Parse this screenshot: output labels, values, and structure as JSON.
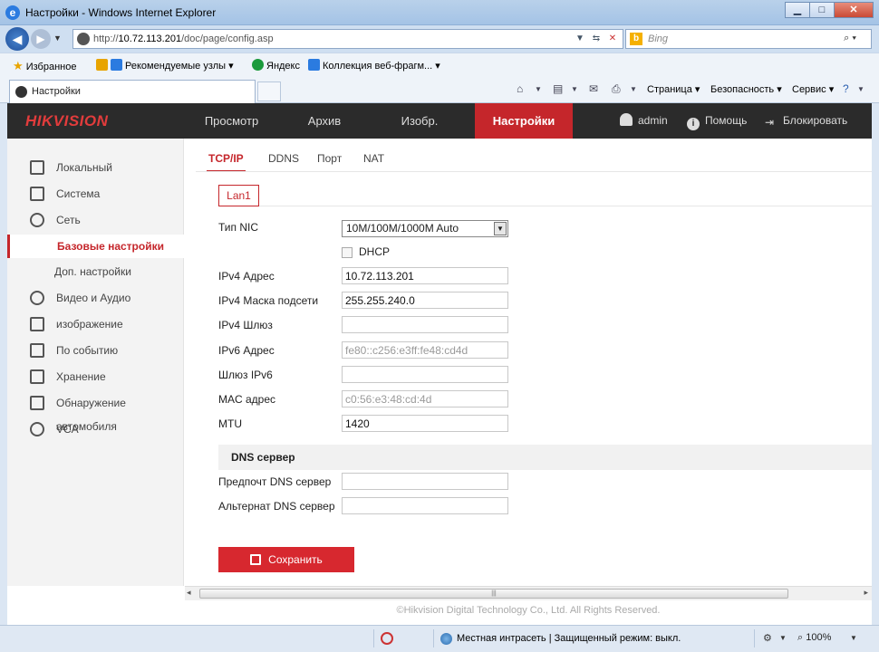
{
  "browser": {
    "window_title": "Настройки - Windows Internet Explorer",
    "address_prefix": "http://",
    "address_host": "10.72.113.201",
    "address_path": "/doc/page/config.asp",
    "search_placeholder": "Bing",
    "favorites_label": "Избранное",
    "fav_links": [
      "Рекомендуемые узлы ▾",
      "Яндекс",
      "Коллекция веб-фрагм... ▾"
    ],
    "tab_title": "Настройки",
    "commands": [
      "Страница ▾",
      "Безопасность ▾",
      "Сервис ▾"
    ],
    "status_zone": "Местная интрасеть | Защищенный режим: выкл.",
    "zoom": "100%"
  },
  "app": {
    "logo": "HIKVISION",
    "nav": [
      "Просмотр",
      "Архив",
      "Изобр.",
      "Настройки"
    ],
    "active_nav": "Настройки",
    "user": "admin",
    "help": "Помощь",
    "logout": "Блокировать"
  },
  "sidebar": {
    "items": [
      {
        "label": "Локальный",
        "icon": "monitor-icon"
      },
      {
        "label": "Система",
        "icon": "system-icon"
      },
      {
        "label": "Сеть",
        "icon": "globe-icon"
      },
      {
        "label": "Базовые настройки",
        "sub": true,
        "active": true
      },
      {
        "label": "Доп. настройки",
        "sub": true
      },
      {
        "label": "Видео и Аудио",
        "icon": "camera-mic-icon"
      },
      {
        "label": "изображение",
        "icon": "image-icon"
      },
      {
        "label": "По событию",
        "icon": "calendar-icon"
      },
      {
        "label": "Хранение",
        "icon": "disk-icon"
      },
      {
        "label": "Обнаружение автомобиля",
        "icon": "vehicle-search-icon"
      },
      {
        "label": "VCA",
        "icon": "vca-icon"
      }
    ]
  },
  "tabs": [
    "TCP/IP",
    "DDNS",
    "Порт",
    "NAT"
  ],
  "lan_tab": "Lan1",
  "form": {
    "nic_type_label": "Тип NIC",
    "nic_type_value": "10M/100M/1000M Auto",
    "dhcp_label": "DHCP",
    "dhcp_checked": false,
    "ipv4_addr_label": "IPv4 Адрес",
    "ipv4_addr": "10.72.113.201",
    "ipv4_mask_label": "IPv4 Маска подсети",
    "ipv4_mask": "255.255.240.0",
    "ipv4_gw_label": "IPv4 Шлюз",
    "ipv4_gw": "",
    "ipv6_addr_label": "IPv6 Адрес",
    "ipv6_addr": "fe80::c256:e3ff:fe48:cd4d",
    "ipv6_gw_label": "Шлюз IPv6",
    "ipv6_gw": "",
    "mac_label": "MAC адрес",
    "mac": "c0:56:e3:48:cd:4d",
    "mtu_label": "MTU",
    "mtu": "1420",
    "dns_section": "DNS сервер",
    "dns_pref_label": "Предпочт DNS сервер",
    "dns_pref": "",
    "dns_alt_label": "Альтернат DNS сервер",
    "dns_alt": "",
    "save_label": "Сохранить"
  },
  "footer": "©Hikvision Digital Technology Co., Ltd. All Rights Reserved."
}
